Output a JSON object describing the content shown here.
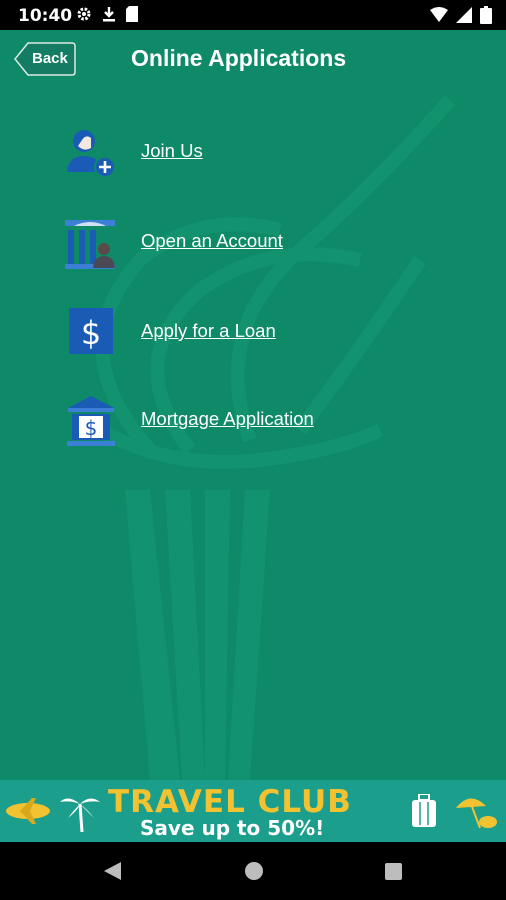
{
  "status_bar": {
    "time": "10:40",
    "left_icons": [
      "gear-icon",
      "download-icon",
      "sd-card-icon"
    ],
    "right_icons": [
      "wifi-icon",
      "cellular-signal-icon",
      "battery-icon"
    ]
  },
  "header": {
    "back_label": "Back",
    "title": "Online Applications"
  },
  "menu": {
    "items": [
      {
        "label": "Join Us",
        "icon": "add-user-icon"
      },
      {
        "label": "Open an Account",
        "icon": "bank-account-icon"
      },
      {
        "label": "Apply for a Loan",
        "icon": "dollar-icon"
      },
      {
        "label": "Mortgage Application",
        "icon": "bank-dollar-icon"
      }
    ]
  },
  "banner": {
    "headline": "TRAVEL CLUB",
    "subline": "Save up to 50%!"
  },
  "nav_bar": {
    "buttons": [
      "back-triangle-icon",
      "home-circle-icon",
      "recents-square-icon"
    ]
  },
  "colors": {
    "background": "#0e8a68",
    "banner_background": "#1c9e8c",
    "banner_headline": "#f2c230",
    "icon_blue": "#1a5bb5"
  }
}
